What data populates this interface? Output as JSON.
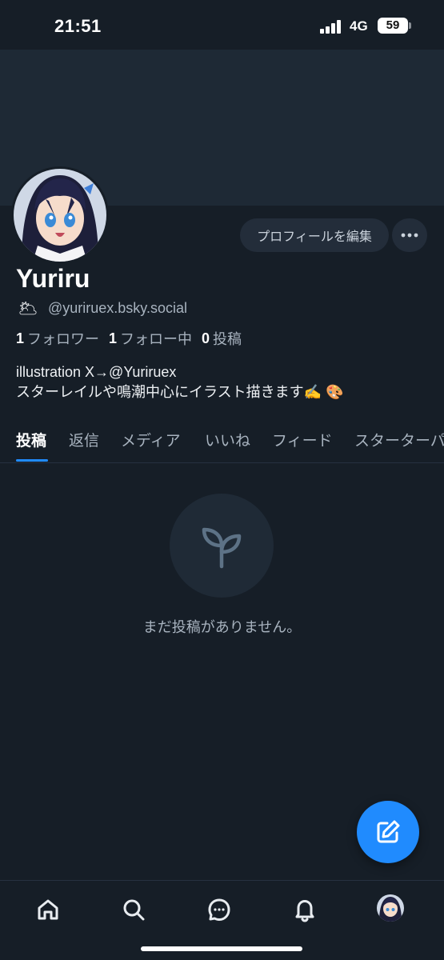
{
  "status_bar": {
    "time": "21:51",
    "network": "4G",
    "battery": "59"
  },
  "profile": {
    "display_name": "Yuriru",
    "handle_emoji": "🌥",
    "handle": "@yuriruex.bsky.social",
    "edit_button": "プロフィールを編集",
    "followers_count": "1",
    "followers_label": "フォロワー",
    "following_count": "1",
    "following_label": "フォロー中",
    "posts_count": "0",
    "posts_label": "投稿",
    "bio_line1": "illustration X→@Yuriruex",
    "bio_line2": "スターレイルや鳴潮中心にイラスト描きます✍️ 🎨"
  },
  "tabs": [
    {
      "label": "投稿"
    },
    {
      "label": "返信"
    },
    {
      "label": "メディア"
    },
    {
      "label": "いいね"
    },
    {
      "label": "フィード"
    },
    {
      "label": "スターターパ"
    }
  ],
  "empty_state": {
    "text": "まだ投稿がありません。",
    "icon": "sprout-icon"
  },
  "colors": {
    "accent": "#208bfe",
    "background": "#161e27",
    "banner": "#1e2935"
  },
  "bottom_nav": [
    "home-icon",
    "search-icon",
    "chat-icon",
    "bell-icon",
    "profile-avatar"
  ]
}
